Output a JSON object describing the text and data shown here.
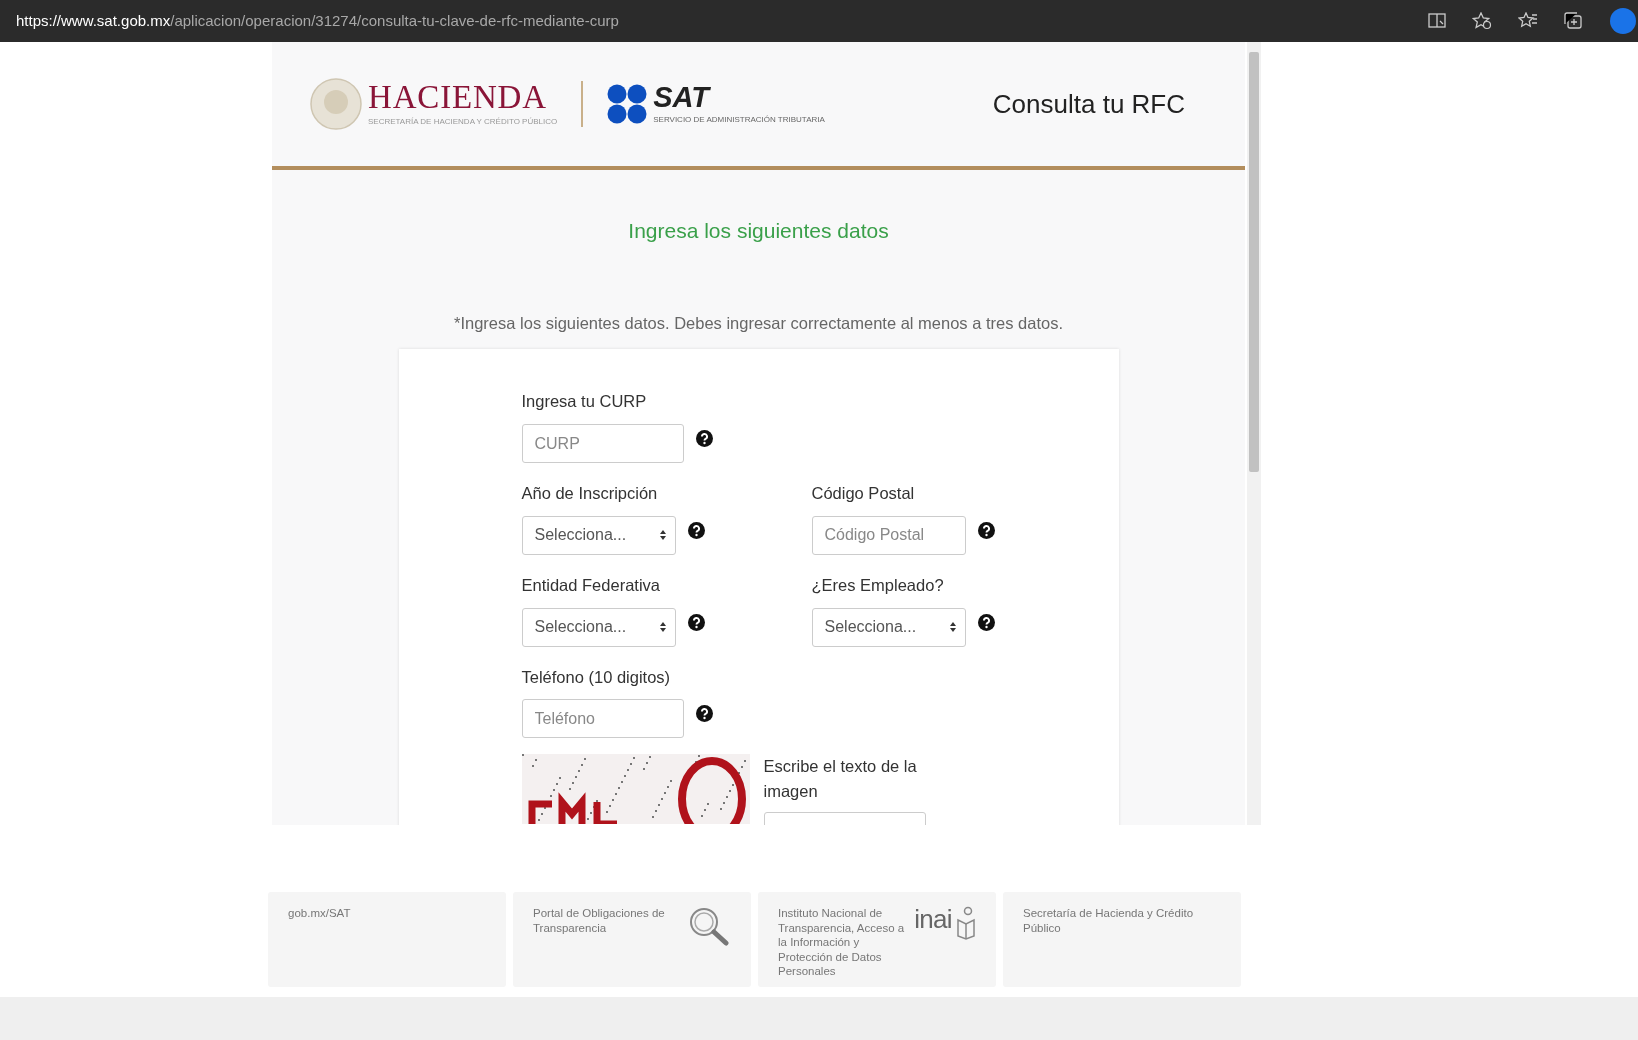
{
  "browser": {
    "url_host": "https://www.sat.gob.mx",
    "url_path": "/aplicacion/operacion/31274/consulta-tu-clave-de-rfc-mediante-curp"
  },
  "header": {
    "hacienda": "HACIENDA",
    "hacienda_sub": "SECRETARÍA DE HACIENDA Y CRÉDITO PÚBLICO",
    "sat": "SAT",
    "sat_sub": "SERVICIO DE ADMINISTRACIÓN TRIBUTARIA",
    "title": "Consulta tu RFC"
  },
  "heading": "Ingresa los siguientes datos",
  "note": "*Ingresa los siguientes datos. Debes ingresar correctamente al menos a tres datos.",
  "form_rows": [
    [
      {
        "kind": "input",
        "label": "Ingresa tu CURP",
        "placeholder": "CURP"
      }
    ],
    [
      {
        "kind": "select",
        "label": "Año de Inscripción",
        "value": "Selecciona..."
      },
      {
        "kind": "input",
        "label": "Código Postal",
        "placeholder": "Código Postal"
      }
    ],
    [
      {
        "kind": "select",
        "label": "Entidad Federativa",
        "value": "Selecciona..."
      },
      {
        "kind": "select",
        "label": "¿Eres Empleado?",
        "value": "Selecciona..."
      }
    ],
    [
      {
        "kind": "input",
        "label": "Teléfono (10 digitos)",
        "placeholder": "Teléfono"
      }
    ]
  ],
  "captcha": {
    "label": "Escribe el texto de la imagen"
  },
  "footer": [
    {
      "kind": "plain",
      "text": "gob.mx/SAT"
    },
    {
      "kind": "search",
      "text": "Portal de Obligaciones de Transparencia"
    },
    {
      "kind": "inai",
      "text": "Instituto Nacional de Transparencia, Acceso a la Información y Protección de Datos Personales",
      "logo_text": "inai"
    },
    {
      "kind": "plain",
      "text": "Secretaría de Hacienda y Crédito Público"
    }
  ]
}
